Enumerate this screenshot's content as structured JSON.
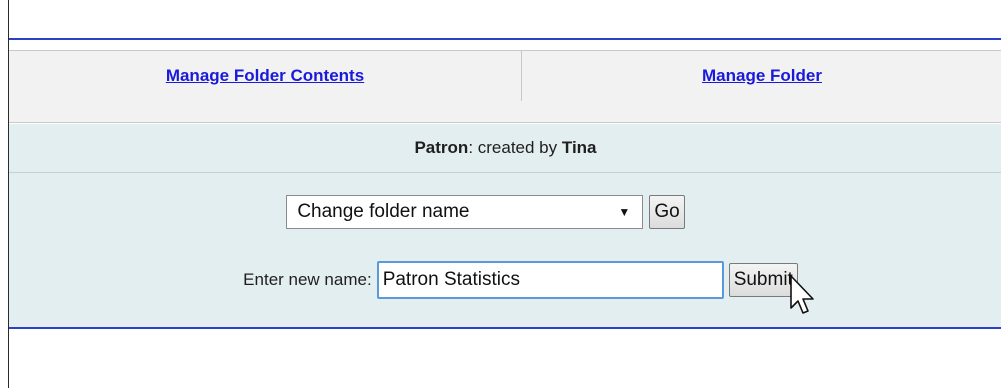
{
  "tabs": {
    "left_label": "Manage Folder Contents",
    "right_label": "Manage Folder"
  },
  "folder": {
    "name": "Patron",
    "created_by_text": ": created by ",
    "creator": "Tina"
  },
  "action_select": {
    "selected": "Change folder name",
    "go_label": "Go"
  },
  "rename": {
    "label": "Enter new name:",
    "value": "Patron Statistics",
    "submit_label": "Submit"
  },
  "colors": {
    "link": "#1a1adb",
    "divider_blue": "#2c3fc9",
    "panel_bg": "#e3eef0"
  }
}
